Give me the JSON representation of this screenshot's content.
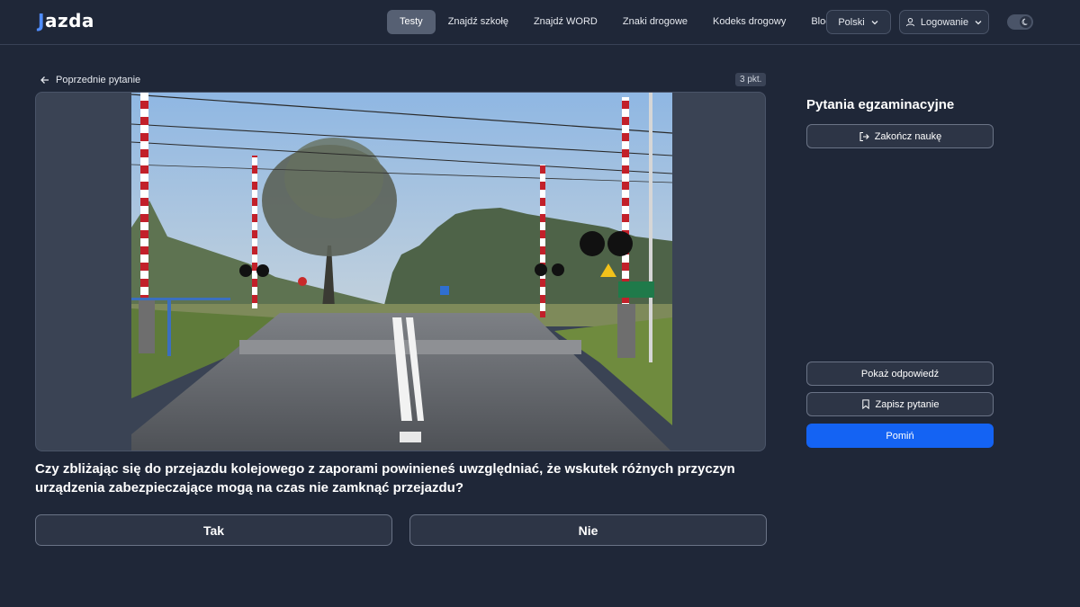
{
  "header": {
    "logo_mark": "J",
    "logo_text": "azda",
    "nav": [
      "Testy",
      "Znajdź szkołę",
      "Znajdź WORD",
      "Znaki drogowe",
      "Kodeks drogowy",
      "Blog"
    ],
    "active_nav": "Testy",
    "language": "Polski",
    "login": "Logowanie",
    "theme_icon": "moon-icon"
  },
  "main": {
    "prev_link": "Poprzednie pytanie",
    "points": "3 pkt.",
    "question": "Czy zbliżając się do przejazdu kolejowego z zaporami powinieneś uwzględniać, że wskutek różnych przyczyn urządzenia zabezpieczające mogą na czas nie zamknąć przejazdu?",
    "answers": [
      "Tak",
      "Nie"
    ]
  },
  "sidebar": {
    "title": "Pytania egzaminacyjne",
    "finish": "Zakończ naukę",
    "show_answer": "Pokaż odpowiedź",
    "save_question": "Zapisz pytanie",
    "skip": "Pomiń"
  },
  "colors": {
    "background": "#1f2738",
    "accent": "#1463f3",
    "active_nav": "#566073"
  }
}
